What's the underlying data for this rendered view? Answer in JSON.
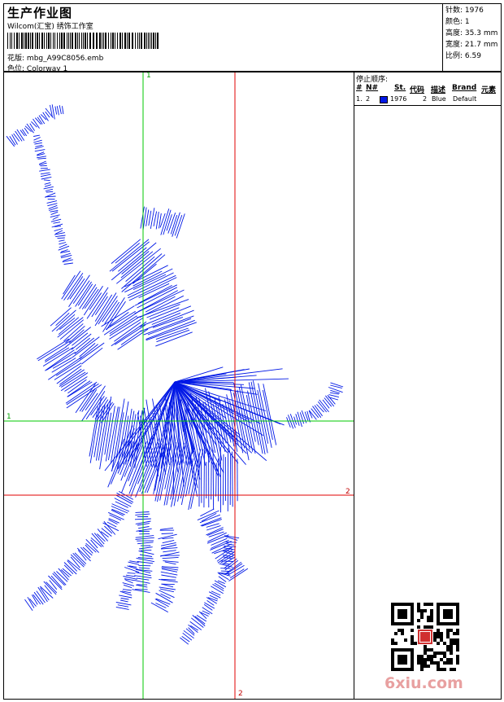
{
  "header": {
    "title": "生产作业图",
    "company": "Wilcom(汇宝) 绣饰工作室",
    "design_label": "花版:",
    "design_name": "mbg_A99C8056.emb",
    "colorway_label": "色位:",
    "colorway_name": "Colorway 1"
  },
  "stats": {
    "stitches_label": "针数:",
    "stitches": "1976",
    "colors_label": "颜色:",
    "colors": "1",
    "height_label": "高度:",
    "height": "35.3 mm",
    "width_label": "宽度:",
    "width": "21.7 mm",
    "ratio_label": "比例:",
    "ratio": "6.59"
  },
  "stop_sequence": {
    "title": "停止顺序:",
    "headers": [
      "#",
      "N#",
      "St.",
      "代码",
      "描述",
      "Brand",
      "元素"
    ],
    "rows": [
      {
        "num": "1.",
        "n": "2",
        "color": "#0018e6",
        "stitches": "1976",
        "code": "2",
        "desc": "Blue",
        "brand": "Default"
      }
    ]
  },
  "guides": {
    "green_v_label": "1",
    "green_h_label": "1",
    "red_v_label": "2",
    "red_h_label": "2"
  },
  "watermark": "6xiu.com",
  "colors": {
    "stitch": "#0018e6",
    "guide_green": "#00c800",
    "guide_red": "#e00000"
  }
}
